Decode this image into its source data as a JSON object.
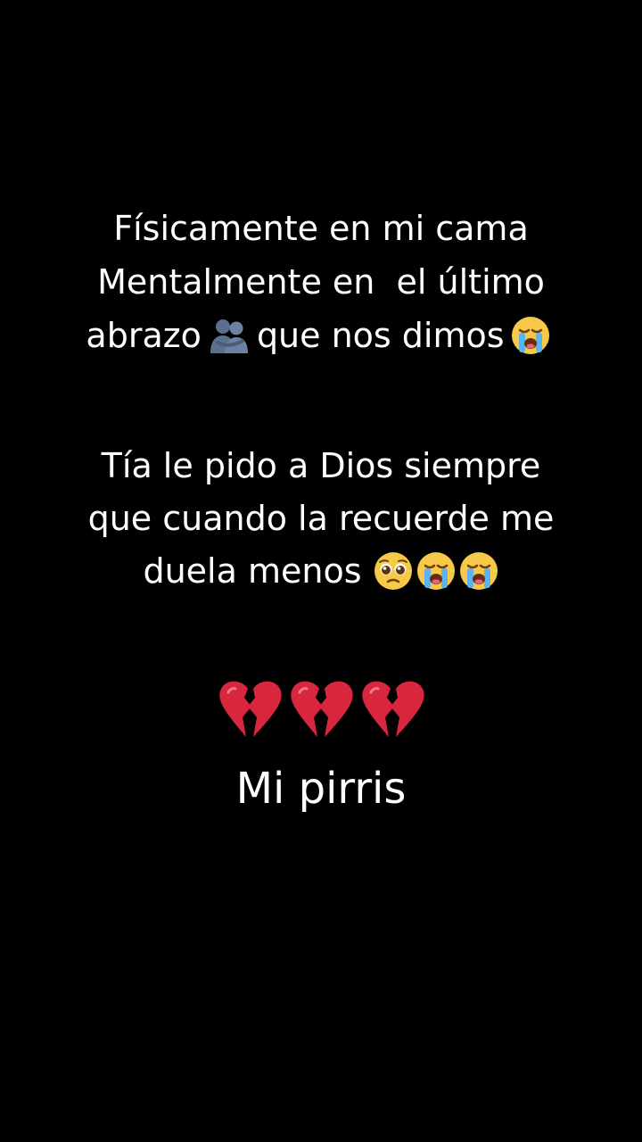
{
  "colors": {
    "background": "#000000",
    "text": "#ffffff"
  },
  "stanza1": {
    "line1": "Físicamente en mi cama",
    "line2": "Mentalmente en  el último",
    "line3_before": "abrazo",
    "line3_middle": "que nos dimos",
    "line3_icons": [
      "people-hugging-icon",
      "loudly-crying-face-icon"
    ]
  },
  "stanza2": {
    "line1": "Tía le pido a Dios siempre",
    "line2": "que cuando la recuerde me",
    "line3": "duela menos",
    "line3_icons": [
      "pleading-face-icon",
      "loudly-crying-face-icon",
      "loudly-crying-face-icon"
    ]
  },
  "hearts": [
    "broken-heart-icon",
    "broken-heart-icon",
    "broken-heart-icon"
  ],
  "signature": "Mi pirris"
}
